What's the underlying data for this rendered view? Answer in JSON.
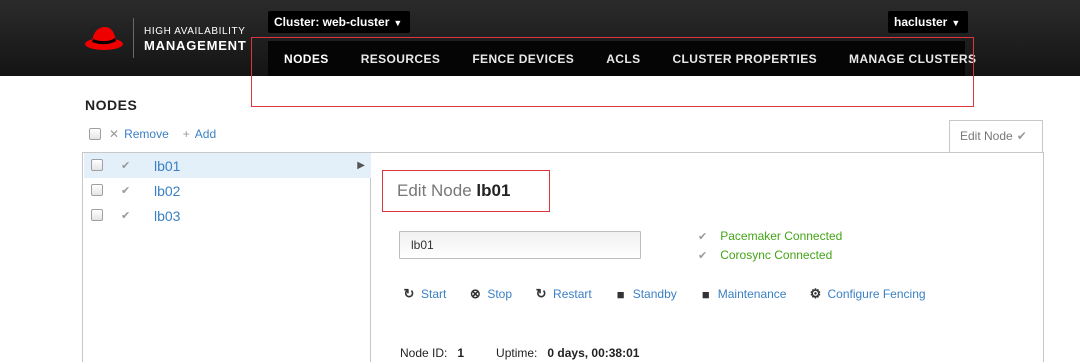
{
  "brand": {
    "line1": "HIGH AVAILABILITY",
    "line2": "MANAGEMENT"
  },
  "header": {
    "cluster_label": "Cluster: web-cluster",
    "user_label": "hacluster"
  },
  "nav": {
    "items": [
      {
        "label": "NODES"
      },
      {
        "label": "RESOURCES"
      },
      {
        "label": "FENCE DEVICES"
      },
      {
        "label": "ACLS"
      },
      {
        "label": "CLUSTER PROPERTIES"
      },
      {
        "label": "MANAGE CLUSTERS"
      }
    ],
    "active": "NODES"
  },
  "page": {
    "title": "NODES"
  },
  "toolbar": {
    "remove_label": "Remove",
    "add_label": "Add"
  },
  "tab": {
    "label": "Edit Node"
  },
  "nodes": [
    {
      "name": "lb01"
    },
    {
      "name": "lb02"
    },
    {
      "name": "lb03"
    }
  ],
  "edit": {
    "heading_prefix": "Edit Node",
    "heading_node": "lb01",
    "input_value": "lb01"
  },
  "status": [
    {
      "label": "Pacemaker Connected"
    },
    {
      "label": "Corosync Connected"
    }
  ],
  "actions": {
    "start": "Start",
    "stop": "Stop",
    "restart": "Restart",
    "standby": "Standby",
    "maintenance": "Maintenance",
    "configure_fencing": "Configure Fencing"
  },
  "info": {
    "node_id_label": "Node ID:",
    "node_id_value": "1",
    "uptime_label": "Uptime:",
    "uptime_value": "0 days, 00:38:01"
  },
  "colors": {
    "link": "#3b80c4",
    "connected": "#43a516",
    "highlight_box": "#d9363e",
    "selected_row": "#e3f0fa",
    "brand_red": "#ee0000"
  }
}
